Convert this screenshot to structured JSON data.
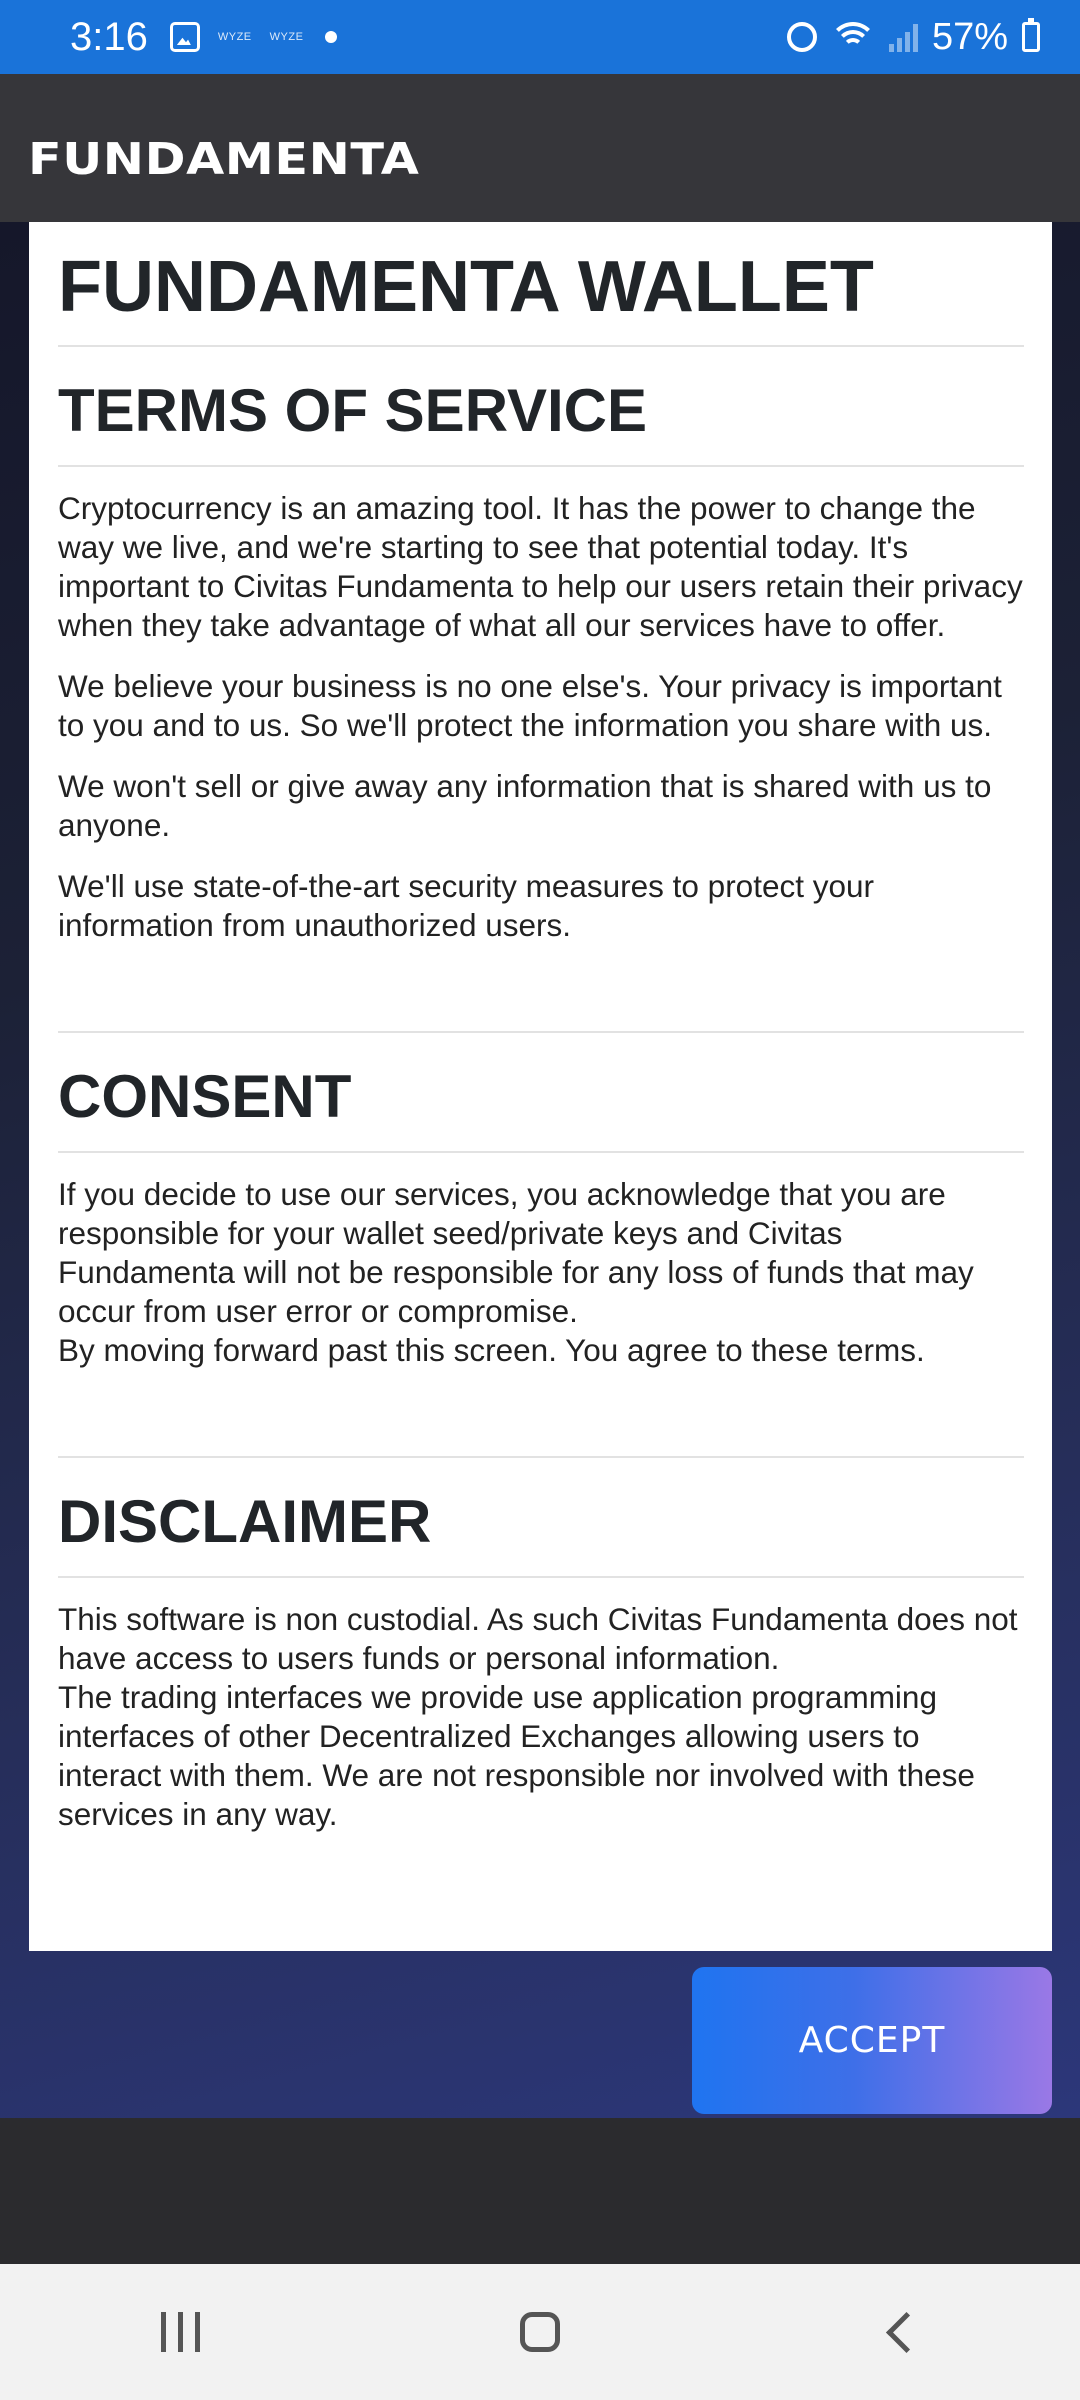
{
  "status_bar": {
    "time": "3:16",
    "notif_1": "WYZE",
    "notif_2": "WYZE",
    "battery": "57%"
  },
  "header": {
    "brand": "FUNDAMENTA"
  },
  "card": {
    "title": "FUNDAMENTA WALLET",
    "terms": {
      "heading": "TERMS OF SERVICE",
      "paragraphs": [
        "Cryptocurrency is an amazing tool. It has the power to change the way we live, and we're starting to see that potential today. It's important to Civitas Fundamenta to help our users retain their privacy when they take advantage of what all our services have to offer.",
        "We believe your business is no one else's. Your privacy is important to you and to us. So we'll protect the information you share with us.",
        "We won't sell or give away any information that is shared with us to anyone.",
        "We'll use state-of-the-art security measures to protect your information from unauthorized users."
      ]
    },
    "consent": {
      "heading": "CONSENT",
      "paragraphs": [
        "If you decide to use our services, you acknowledge that you are responsible for your wallet seed/private keys and Civitas Fundamenta will not be responsible for any loss of funds that may occur from user error or compromise.",
        "By moving forward past this screen. You agree to these terms."
      ]
    },
    "disclaimer": {
      "heading": "DISCLAIMER",
      "paragraphs": [
        "This software is non custodial. As such Civitas Fundamenta does not have access to users funds or personal information.",
        "The trading interfaces we provide use application programming interfaces of other Decentralized Exchanges allowing users to interact with them. We are not responsible nor involved with these services in any way."
      ]
    }
  },
  "accept_label": "ACCEPT",
  "icons": {
    "status": [
      "image-icon",
      "alarm-icon",
      "wifi-icon",
      "signal-icon",
      "battery-icon"
    ],
    "nav": [
      "recents-icon",
      "home-icon",
      "back-icon"
    ]
  },
  "colors": {
    "status_bar": "#1a73d9",
    "header": "#36363a",
    "accept_gradient_start": "#1f74f0",
    "accept_gradient_end": "#9a78e6"
  }
}
